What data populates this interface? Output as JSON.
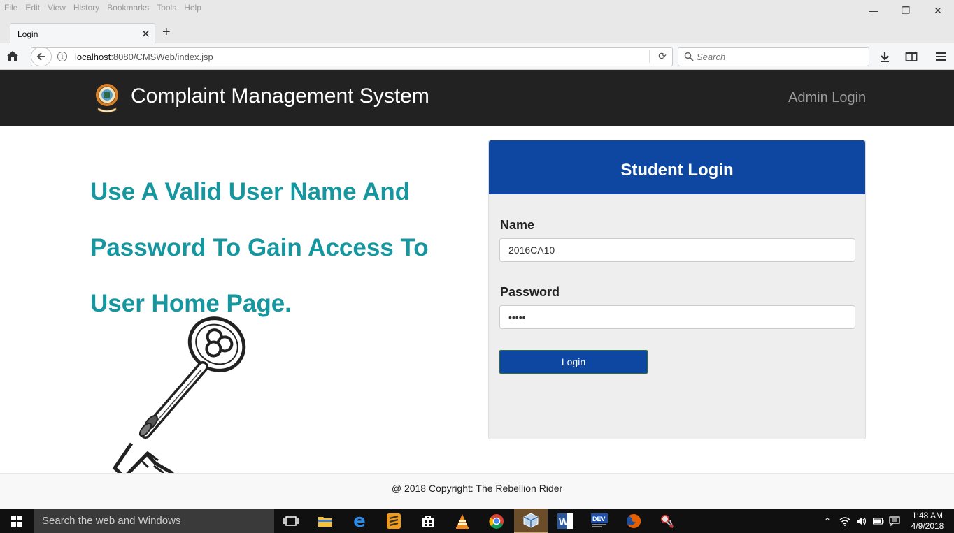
{
  "browser": {
    "menu": [
      "File",
      "Edit",
      "View",
      "History",
      "Bookmarks",
      "Tools",
      "Help"
    ],
    "tab_title": "Login",
    "url_host": "localhost",
    "url_rest": ":8080/CMSWeb/index.jsp",
    "search_placeholder": "Search"
  },
  "page": {
    "brand": "Complaint Management System",
    "admin_link": "Admin Login",
    "headline": "Use A Valid User Name And Password To Gain Access To User Home Page.",
    "panel_title": "Student Login",
    "name_label": "Name",
    "name_value": "2016CA10",
    "password_label": "Password",
    "password_value": "12345",
    "login_button": "Login",
    "footer": "@ 2018 Copyright: The Rebellion Rider"
  },
  "taskbar": {
    "search_text": "Search the web and Windows",
    "time": "1:48 AM",
    "date": "4/9/2018"
  },
  "colors": {
    "header_bg": "#222222",
    "accent_blue": "#0e47a1",
    "headline_teal": "#16969e",
    "panel_bg": "#eeeeee"
  }
}
